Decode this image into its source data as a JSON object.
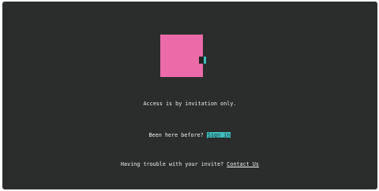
{
  "access": {
    "message": "Access is by invitation only."
  },
  "returning": {
    "prompt": "Been here before? ",
    "link_label": "Sign in"
  },
  "trouble": {
    "prompt": "Having trouble with your invite? ",
    "link_label": "Contact Us"
  },
  "colors": {
    "background": "#2b2d2d",
    "logo_pink": "#ec6aa8",
    "accent_teal": "#3fbfbf",
    "text": "#f2f2f2"
  },
  "icons": {
    "logo": "brand-logo-icon"
  }
}
